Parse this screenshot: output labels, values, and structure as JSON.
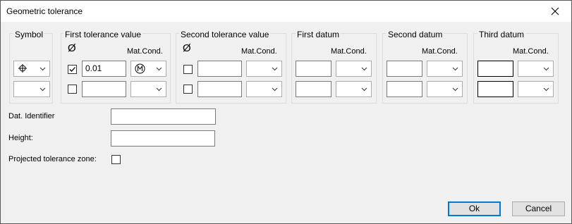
{
  "window": {
    "title": "Geometric tolerance"
  },
  "groups": {
    "symbol": "Symbol",
    "first_tolerance": "First tolerance value",
    "second_tolerance": "Second tolerance value",
    "first_datum": "First datum",
    "second_datum": "Second datum",
    "third_datum": "Third datum"
  },
  "diameter_symbol": "Ø",
  "mat_cond_label": "Mat.Cond.",
  "first_tolerance": {
    "row1_value": "0.01",
    "row1_checked": true,
    "row1_matcond": "Ⓜ",
    "row2_value": "",
    "row2_checked": false
  },
  "second_tolerance": {
    "row1_value": "",
    "row2_value": ""
  },
  "symbol_row1": "⌖",
  "fields": {
    "dat_identifier_label": "Dat. Identifier",
    "dat_identifier_value": "",
    "height_label": "Height:",
    "height_value": "",
    "projected_label": "Projected tolerance zone:"
  },
  "buttons": {
    "ok": "Ok",
    "cancel": "Cancel"
  },
  "colors": {
    "default_button_border": "#0078d7",
    "background": "#f0f0f0"
  }
}
